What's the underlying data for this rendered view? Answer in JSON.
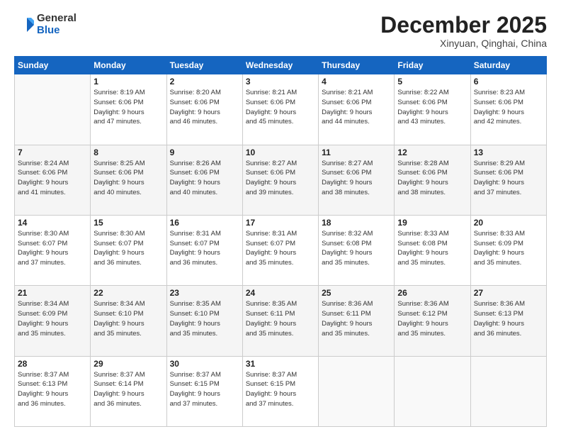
{
  "logo": {
    "general": "General",
    "blue": "Blue"
  },
  "header": {
    "month": "December 2025",
    "location": "Xinyuan, Qinghai, China"
  },
  "weekdays": [
    "Sunday",
    "Monday",
    "Tuesday",
    "Wednesday",
    "Thursday",
    "Friday",
    "Saturday"
  ],
  "weeks": [
    [
      {
        "day": "",
        "info": ""
      },
      {
        "day": "1",
        "info": "Sunrise: 8:19 AM\nSunset: 6:06 PM\nDaylight: 9 hours\nand 47 minutes."
      },
      {
        "day": "2",
        "info": "Sunrise: 8:20 AM\nSunset: 6:06 PM\nDaylight: 9 hours\nand 46 minutes."
      },
      {
        "day": "3",
        "info": "Sunrise: 8:21 AM\nSunset: 6:06 PM\nDaylight: 9 hours\nand 45 minutes."
      },
      {
        "day": "4",
        "info": "Sunrise: 8:21 AM\nSunset: 6:06 PM\nDaylight: 9 hours\nand 44 minutes."
      },
      {
        "day": "5",
        "info": "Sunrise: 8:22 AM\nSunset: 6:06 PM\nDaylight: 9 hours\nand 43 minutes."
      },
      {
        "day": "6",
        "info": "Sunrise: 8:23 AM\nSunset: 6:06 PM\nDaylight: 9 hours\nand 42 minutes."
      }
    ],
    [
      {
        "day": "7",
        "info": "Sunrise: 8:24 AM\nSunset: 6:06 PM\nDaylight: 9 hours\nand 41 minutes."
      },
      {
        "day": "8",
        "info": "Sunrise: 8:25 AM\nSunset: 6:06 PM\nDaylight: 9 hours\nand 40 minutes."
      },
      {
        "day": "9",
        "info": "Sunrise: 8:26 AM\nSunset: 6:06 PM\nDaylight: 9 hours\nand 40 minutes."
      },
      {
        "day": "10",
        "info": "Sunrise: 8:27 AM\nSunset: 6:06 PM\nDaylight: 9 hours\nand 39 minutes."
      },
      {
        "day": "11",
        "info": "Sunrise: 8:27 AM\nSunset: 6:06 PM\nDaylight: 9 hours\nand 38 minutes."
      },
      {
        "day": "12",
        "info": "Sunrise: 8:28 AM\nSunset: 6:06 PM\nDaylight: 9 hours\nand 38 minutes."
      },
      {
        "day": "13",
        "info": "Sunrise: 8:29 AM\nSunset: 6:06 PM\nDaylight: 9 hours\nand 37 minutes."
      }
    ],
    [
      {
        "day": "14",
        "info": "Sunrise: 8:30 AM\nSunset: 6:07 PM\nDaylight: 9 hours\nand 37 minutes."
      },
      {
        "day": "15",
        "info": "Sunrise: 8:30 AM\nSunset: 6:07 PM\nDaylight: 9 hours\nand 36 minutes."
      },
      {
        "day": "16",
        "info": "Sunrise: 8:31 AM\nSunset: 6:07 PM\nDaylight: 9 hours\nand 36 minutes."
      },
      {
        "day": "17",
        "info": "Sunrise: 8:31 AM\nSunset: 6:07 PM\nDaylight: 9 hours\nand 35 minutes."
      },
      {
        "day": "18",
        "info": "Sunrise: 8:32 AM\nSunset: 6:08 PM\nDaylight: 9 hours\nand 35 minutes."
      },
      {
        "day": "19",
        "info": "Sunrise: 8:33 AM\nSunset: 6:08 PM\nDaylight: 9 hours\nand 35 minutes."
      },
      {
        "day": "20",
        "info": "Sunrise: 8:33 AM\nSunset: 6:09 PM\nDaylight: 9 hours\nand 35 minutes."
      }
    ],
    [
      {
        "day": "21",
        "info": "Sunrise: 8:34 AM\nSunset: 6:09 PM\nDaylight: 9 hours\nand 35 minutes."
      },
      {
        "day": "22",
        "info": "Sunrise: 8:34 AM\nSunset: 6:10 PM\nDaylight: 9 hours\nand 35 minutes."
      },
      {
        "day": "23",
        "info": "Sunrise: 8:35 AM\nSunset: 6:10 PM\nDaylight: 9 hours\nand 35 minutes."
      },
      {
        "day": "24",
        "info": "Sunrise: 8:35 AM\nSunset: 6:11 PM\nDaylight: 9 hours\nand 35 minutes."
      },
      {
        "day": "25",
        "info": "Sunrise: 8:36 AM\nSunset: 6:11 PM\nDaylight: 9 hours\nand 35 minutes."
      },
      {
        "day": "26",
        "info": "Sunrise: 8:36 AM\nSunset: 6:12 PM\nDaylight: 9 hours\nand 35 minutes."
      },
      {
        "day": "27",
        "info": "Sunrise: 8:36 AM\nSunset: 6:13 PM\nDaylight: 9 hours\nand 36 minutes."
      }
    ],
    [
      {
        "day": "28",
        "info": "Sunrise: 8:37 AM\nSunset: 6:13 PM\nDaylight: 9 hours\nand 36 minutes."
      },
      {
        "day": "29",
        "info": "Sunrise: 8:37 AM\nSunset: 6:14 PM\nDaylight: 9 hours\nand 36 minutes."
      },
      {
        "day": "30",
        "info": "Sunrise: 8:37 AM\nSunset: 6:15 PM\nDaylight: 9 hours\nand 37 minutes."
      },
      {
        "day": "31",
        "info": "Sunrise: 8:37 AM\nSunset: 6:15 PM\nDaylight: 9 hours\nand 37 minutes."
      },
      {
        "day": "",
        "info": ""
      },
      {
        "day": "",
        "info": ""
      },
      {
        "day": "",
        "info": ""
      }
    ]
  ]
}
